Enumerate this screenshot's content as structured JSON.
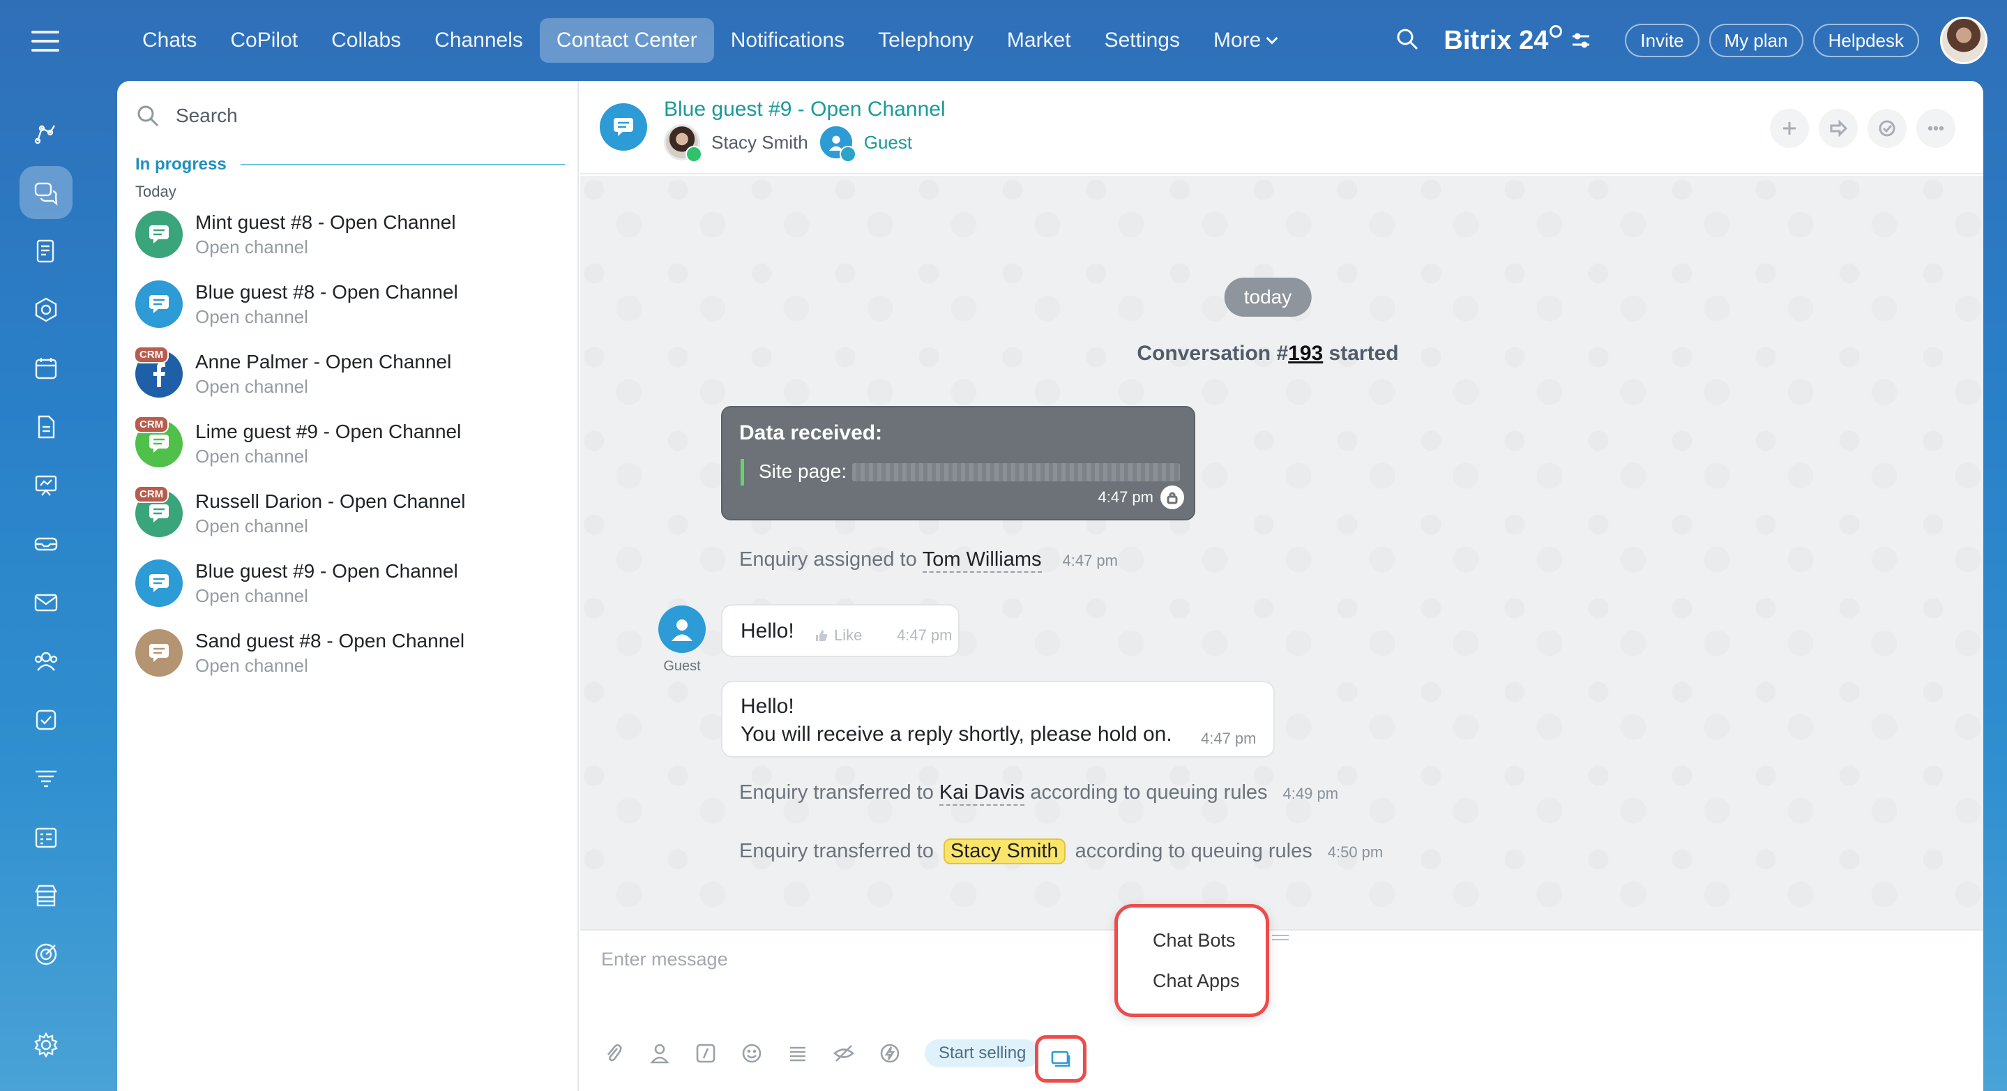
{
  "rail": {
    "items": [
      {
        "icon": "feed-icon"
      },
      {
        "icon": "messenger-icon",
        "active": true
      },
      {
        "icon": "document-icon"
      },
      {
        "icon": "hexagon-icon"
      },
      {
        "icon": "calendar-icon"
      },
      {
        "icon": "file-icon"
      },
      {
        "icon": "presentation-icon"
      },
      {
        "icon": "inbox-tray-icon"
      },
      {
        "icon": "mail-icon"
      },
      {
        "icon": "contacts-icon"
      },
      {
        "icon": "task-checkbox-icon"
      },
      {
        "icon": "filter-funnel-icon"
      },
      {
        "icon": "planner-icon"
      },
      {
        "icon": "store-icon"
      },
      {
        "icon": "target-icon"
      },
      {
        "icon": "settings-gear-icon"
      }
    ]
  },
  "topnav": {
    "items": [
      "Chats",
      "CoPilot",
      "Collabs",
      "Channels",
      "Contact Center",
      "Notifications",
      "Telephony",
      "Market",
      "Settings",
      "More"
    ],
    "active_index": 4
  },
  "header": {
    "brand": "Bitrix 24",
    "invite": "Invite",
    "my_plan": "My plan",
    "helpdesk": "Helpdesk"
  },
  "list": {
    "search_placeholder": "Search",
    "section": "In progress",
    "day": "Today",
    "items": [
      {
        "title": "Mint guest #8 - Open Channel",
        "sub": "Open channel",
        "color": "#3aa57a",
        "crm": false,
        "kind": "chat"
      },
      {
        "title": "Blue guest #8 - Open Channel",
        "sub": "Open channel",
        "color": "#2c9bd6",
        "crm": false,
        "kind": "chat"
      },
      {
        "title": "Anne Palmer - Open Channel",
        "sub": "Open channel",
        "color": "#1f5fa8",
        "crm": true,
        "kind": "facebook"
      },
      {
        "title": "Lime guest #9 - Open Channel",
        "sub": "Open channel",
        "color": "#4fc04a",
        "crm": true,
        "kind": "chat"
      },
      {
        "title": "Russell Darion - Open Channel",
        "sub": "Open channel",
        "color": "#3aa57a",
        "crm": true,
        "kind": "chat"
      },
      {
        "title": "Blue guest #9 - Open Channel",
        "sub": "Open channel",
        "color": "#2c9bd6",
        "crm": false,
        "kind": "chat"
      },
      {
        "title": "Sand guest #8 - Open Channel",
        "sub": "Open channel",
        "color": "#b59471",
        "crm": false,
        "kind": "chat"
      }
    ],
    "crm_label": "CRM"
  },
  "chat": {
    "title": "Blue guest #9 - Open Channel",
    "member1": "Stacy Smith",
    "member2": "Guest",
    "date_pill": "today",
    "conv_prefix": "Conversation #",
    "conv_num": "193",
    "conv_suffix": "started",
    "data_card": {
      "title": "Data received:",
      "label": "Site page:",
      "time": "4:47 pm"
    },
    "assigned": {
      "text": "Enquiry assigned to",
      "person": "Tom Williams",
      "time": "4:47 pm"
    },
    "guest_caption": "Guest",
    "hello": {
      "text": "Hello!",
      "like": "Like",
      "time": "4:47 pm"
    },
    "reply": {
      "line1": "Hello!",
      "line2": "You will receive a reply shortly, please hold on.",
      "time": "4:47 pm"
    },
    "transfer1": {
      "text": "Enquiry transferred to",
      "person": "Kai Davis",
      "rule": "according to queuing rules",
      "time": "4:49 pm"
    },
    "transfer2": {
      "text": "Enquiry transferred to",
      "person": "Stacy Smith",
      "rule": "according to queuing rules",
      "time": "4:50 pm"
    }
  },
  "composer": {
    "placeholder": "Enter message",
    "start_selling": "Start selling",
    "menu": {
      "bots": "Chat Bots",
      "apps": "Chat Apps"
    }
  },
  "colors": {
    "accent": "#2c9bd6",
    "highlight_outline": "#ef4b4b",
    "title_teal": "#1a9a9a"
  }
}
